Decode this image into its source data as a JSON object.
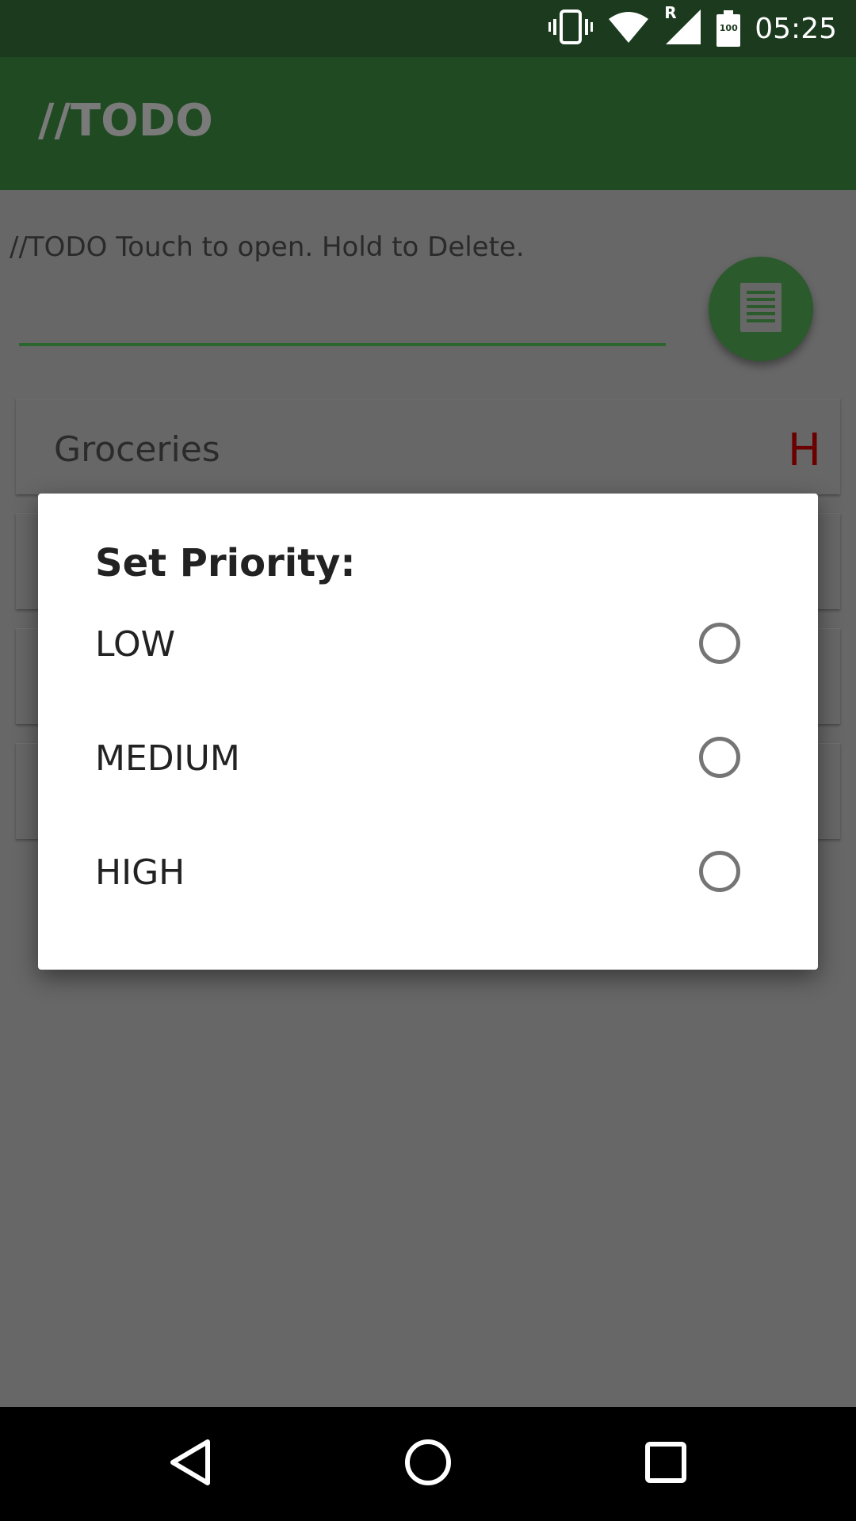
{
  "status_bar": {
    "time": "05:25",
    "battery_level": "100",
    "network_roaming_badge": "R",
    "icons": [
      "vibrate-icon",
      "wifi-icon",
      "cell-signal-icon",
      "battery-icon"
    ]
  },
  "app_bar": {
    "title": "//TODO"
  },
  "main": {
    "hint": "//TODO Touch to open. Hold to Delete.",
    "input_value": "",
    "fab_icon": "notes-icon",
    "items": [
      {
        "title": "Groceries",
        "priority": "H"
      },
      {
        "title": "",
        "priority": ""
      },
      {
        "title": "",
        "priority": ""
      },
      {
        "title": "",
        "priority": ""
      }
    ]
  },
  "dialog": {
    "title": "Set Priority:",
    "options": [
      {
        "label": "LOW",
        "selected": false
      },
      {
        "label": "MEDIUM",
        "selected": false
      },
      {
        "label": "HIGH",
        "selected": false
      }
    ]
  },
  "nav_bar": {
    "buttons": [
      "back-icon",
      "home-icon",
      "recents-icon"
    ]
  },
  "colors": {
    "app_bar": "#1f4a22",
    "status_bar": "#1b3a1e",
    "scrim_background": "#676767",
    "accent_green": "#2c662f",
    "priority_high": "#6a0000",
    "dialog_background": "#ffffff"
  }
}
